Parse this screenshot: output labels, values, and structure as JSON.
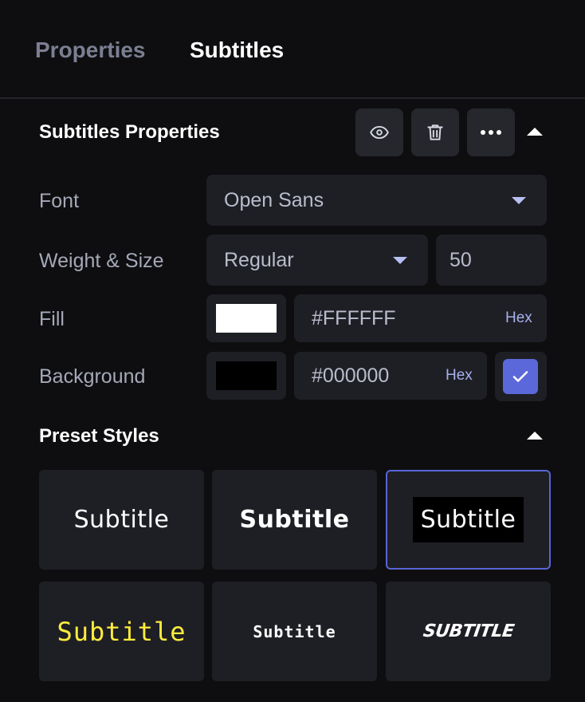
{
  "tabs": [
    {
      "label": "Properties",
      "active": false
    },
    {
      "label": "Subtitles",
      "active": true
    }
  ],
  "subtitles_properties": {
    "title": "Subtitles Properties",
    "actions": [
      "eye-icon",
      "trash-icon",
      "more-icon",
      "collapse-caret-icon"
    ],
    "font": {
      "label": "Font",
      "value": "Open Sans"
    },
    "weight_size": {
      "label": "Weight & Size",
      "weight": "Regular",
      "size": "50"
    },
    "fill": {
      "label": "Fill",
      "color": "#FFFFFF",
      "value": "#FFFFFF",
      "suffix": "Hex"
    },
    "background": {
      "label": "Background",
      "color": "#000000",
      "value": "#000000",
      "suffix": "Hex",
      "enabled": true
    }
  },
  "preset_styles": {
    "title": "Preset Styles",
    "items": [
      {
        "text": "Subtitle",
        "selected": false
      },
      {
        "text": "Subtitle",
        "selected": false
      },
      {
        "text": "Subtitle",
        "selected": true
      },
      {
        "text": "Subtitle",
        "selected": false
      },
      {
        "text": "Subtitle",
        "selected": false
      },
      {
        "text": "SUBTITLE",
        "selected": false
      }
    ]
  },
  "colors": {
    "accent": "#5B68D9",
    "panel_bg": "#0E0E10",
    "field_bg": "#1E1F25",
    "yellow_preset": "#FFEC3D"
  }
}
